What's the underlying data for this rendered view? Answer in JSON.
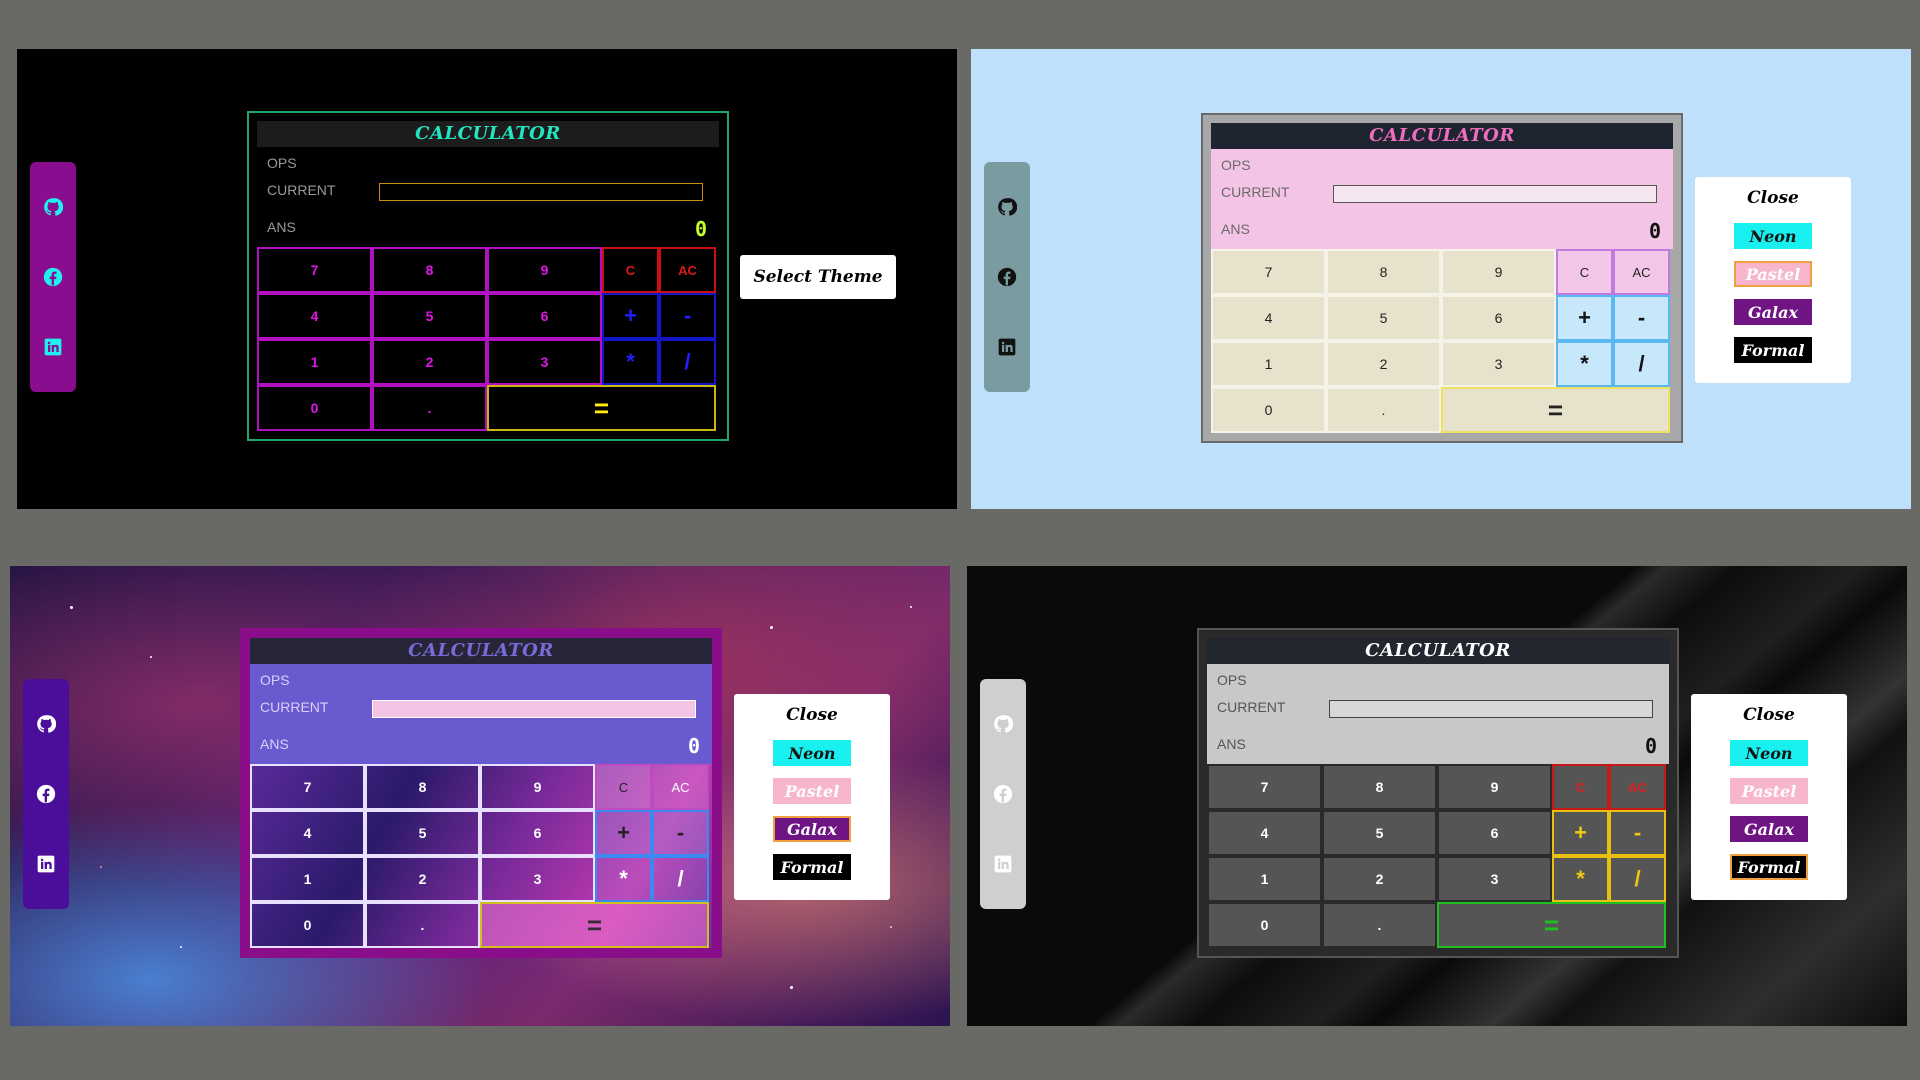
{
  "calculator": {
    "title": "CALCULATOR",
    "ops_label": "OPS",
    "current_label": "CURRENT",
    "ans_label": "ANS",
    "ans_value": "0",
    "keys": [
      "7",
      "8",
      "9",
      "C",
      "AC",
      "4",
      "5",
      "6",
      "+",
      "-",
      "1",
      "2",
      "3",
      "*",
      "/",
      "0",
      ".",
      "="
    ]
  },
  "social": [
    "github-icon",
    "facebook-icon",
    "linkedin-icon"
  ],
  "select_theme_label": "Select Theme",
  "menu": {
    "close_label": "Close",
    "themes": [
      "Neon",
      "Pastel",
      "Galax",
      "Formal"
    ]
  },
  "panels": {
    "neon": {
      "selected": "",
      "accent": "#e014e6"
    },
    "pastel": {
      "selected": "Pastel",
      "accent": "#f4c4e6"
    },
    "galax": {
      "selected": "Galax",
      "accent": "#6a5ad0"
    },
    "formal": {
      "selected": "Formal",
      "accent": "#c8c8c8"
    }
  }
}
